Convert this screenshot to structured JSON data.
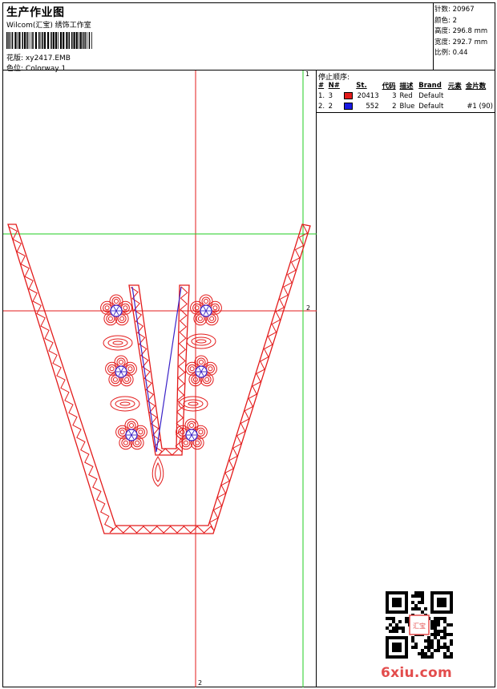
{
  "header": {
    "title": "生产作业图",
    "company": "Wilcom(汇宝) 绣饰工作室",
    "pattern_label": "花版:",
    "pattern_value": "xy2417.EMB",
    "color_label": "色位:",
    "color_value": "Colorway 1"
  },
  "stats": {
    "stitches": "针数: 20967",
    "colors": "颜色: 2",
    "height": "高度: 296.8 mm",
    "width": "宽度: 292.7 mm",
    "scale": "比例: 0.44"
  },
  "stop_sequence": {
    "title": "停止顺序:",
    "columns": [
      "#",
      "N#",
      "St.",
      "代码",
      "描述",
      "Brand",
      "元素",
      "金片数"
    ],
    "rows": [
      {
        "idx": "1.",
        "n": "3",
        "color": "#e31b1b",
        "st": "20413",
        "code": "3",
        "desc": "Red",
        "brand": "Default",
        "element": "",
        "sequins": ""
      },
      {
        "idx": "2.",
        "n": "2",
        "color": "#1a1ae3",
        "st": "552",
        "code": "2",
        "desc": "Blue",
        "brand": "Default",
        "element": "",
        "sequins": "#1 (90)"
      }
    ]
  },
  "axis_markers": {
    "top_right": "1",
    "right_mid": "2",
    "bottom_mid": "2"
  },
  "logo": "6xiu.com",
  "seal": "汇宝"
}
